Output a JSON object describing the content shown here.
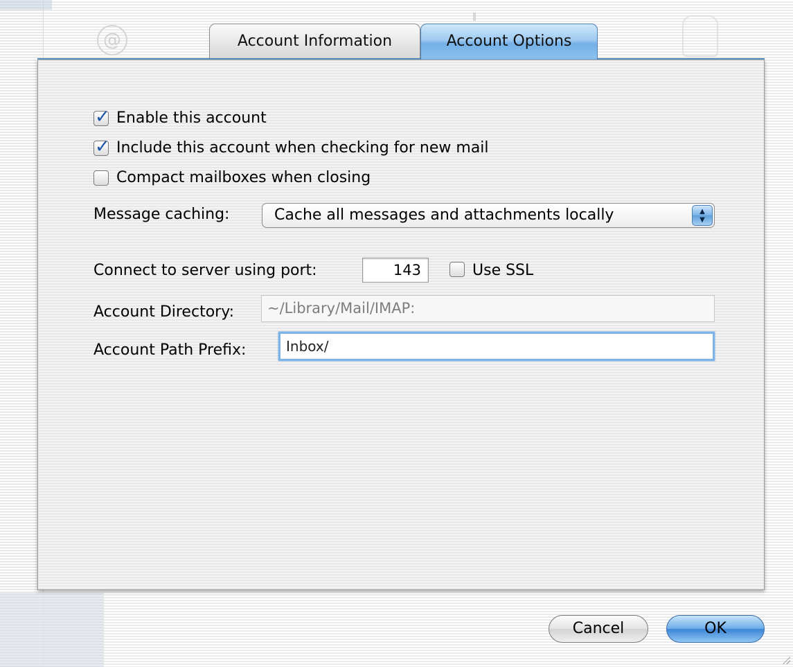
{
  "tabs": [
    {
      "label": "Account Information",
      "selected": false
    },
    {
      "label": "Account Options",
      "selected": true
    }
  ],
  "options": {
    "enable_account": {
      "label": "Enable this account",
      "checked": true
    },
    "include_checking": {
      "label": "Include this account when checking for new mail",
      "checked": true
    },
    "compact_mailboxes": {
      "label": "Compact mailboxes when closing",
      "checked": false
    }
  },
  "message_caching": {
    "label": "Message caching:",
    "selected": "Cache all messages and attachments locally"
  },
  "port": {
    "label": "Connect to server using port:",
    "value": "143",
    "use_ssl_label": "Use SSL",
    "use_ssl_checked": false
  },
  "account_directory": {
    "label": "Account Directory:",
    "value": "~/Library/Mail/IMAP:"
  },
  "account_path_prefix": {
    "label": "Account Path Prefix:",
    "value": "Inbox/"
  },
  "buttons": {
    "cancel": "Cancel",
    "ok": "OK"
  },
  "icons": {
    "checkmark": "✓",
    "popup_arrows": "▲▼"
  },
  "colors": {
    "accent_blue": "#74b0e6",
    "focus_ring": "#7cb4ea"
  }
}
